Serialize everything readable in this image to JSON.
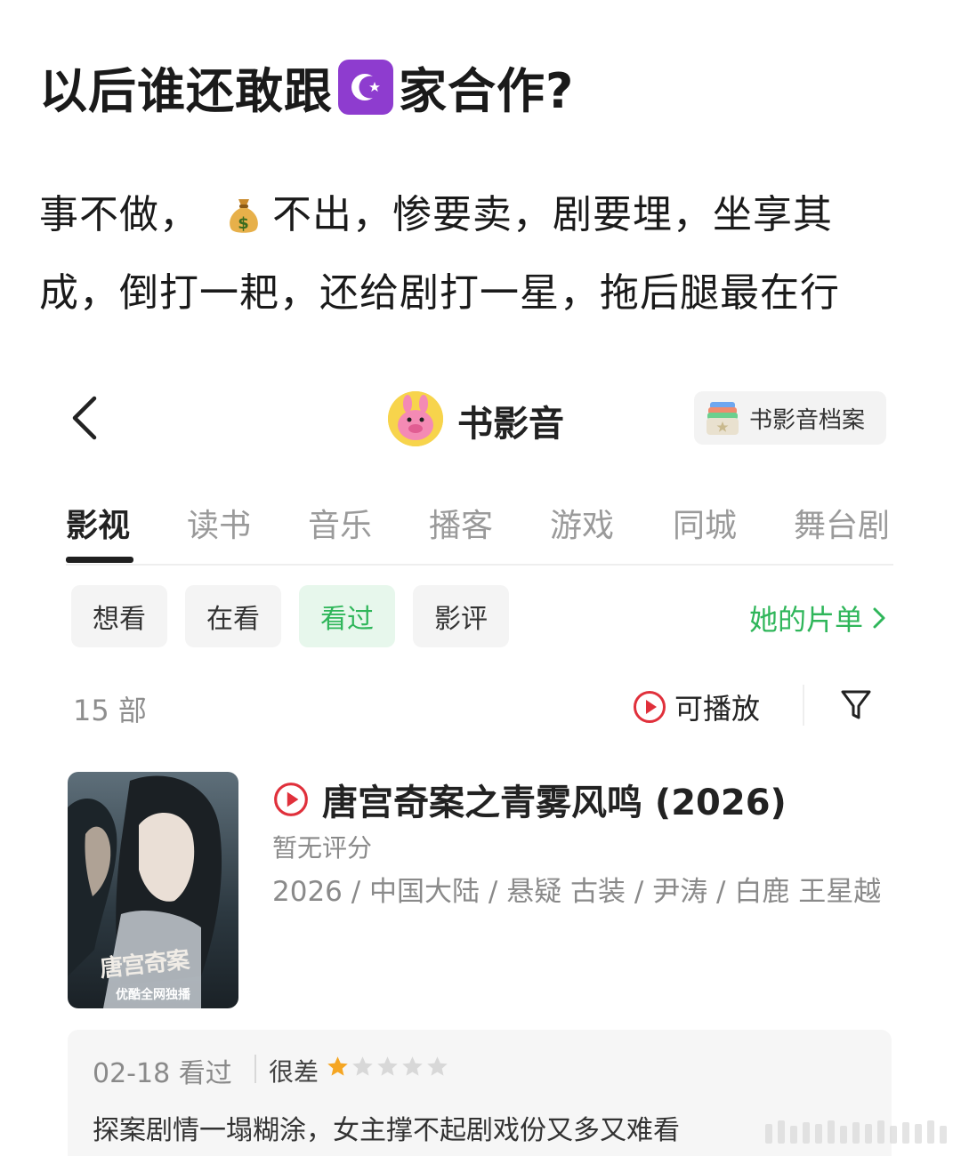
{
  "post": {
    "title_before": "以后谁还敢跟",
    "title_icon": "star-and-crescent-icon",
    "title_after": "家合作?",
    "body_line1_before": "事不做，",
    "body_icon": "money-bag-icon",
    "body_line1_after": "不出，惨要卖，剧要埋，坐享其",
    "body_line2": "成，倒打一耙，还给剧打一星，拖后腿最在行"
  },
  "app": {
    "title": "书影音",
    "archive_button": "书影音档案"
  },
  "tabs": [
    {
      "label": "影视",
      "active": true
    },
    {
      "label": "读书",
      "active": false
    },
    {
      "label": "音乐",
      "active": false
    },
    {
      "label": "播客",
      "active": false
    },
    {
      "label": "游戏",
      "active": false
    },
    {
      "label": "同城",
      "active": false
    },
    {
      "label": "舞台剧",
      "active": false
    }
  ],
  "filters": [
    {
      "label": "想看",
      "active": false
    },
    {
      "label": "在看",
      "active": false
    },
    {
      "label": "看过",
      "active": true
    },
    {
      "label": "影评",
      "active": false
    }
  ],
  "list_link": "她的片单",
  "count": "15 部",
  "playable_toggle": "可播放",
  "movie": {
    "title": "唐宫奇案之青雾风鸣 (2026)",
    "rating_status": "暂无评分",
    "meta": "2026 / 中国大陆 / 悬疑 古装 / 尹涛 / 白鹿 王星越",
    "poster_badge": "优酷全网独播",
    "poster_title": "唐宫奇案"
  },
  "review": {
    "date": "02-18 看过",
    "verdict": "很差",
    "stars_filled": 1,
    "stars_total": 5,
    "text": "探案剧情一塌糊涂，女主撑不起剧戏份又多又难看"
  },
  "colors": {
    "accent_green": "#2fb65a",
    "play_red": "#e0303b",
    "star_orange": "#f5a623",
    "star_empty": "#d8d8d8",
    "crescent_purple": "#8e3ccf"
  }
}
